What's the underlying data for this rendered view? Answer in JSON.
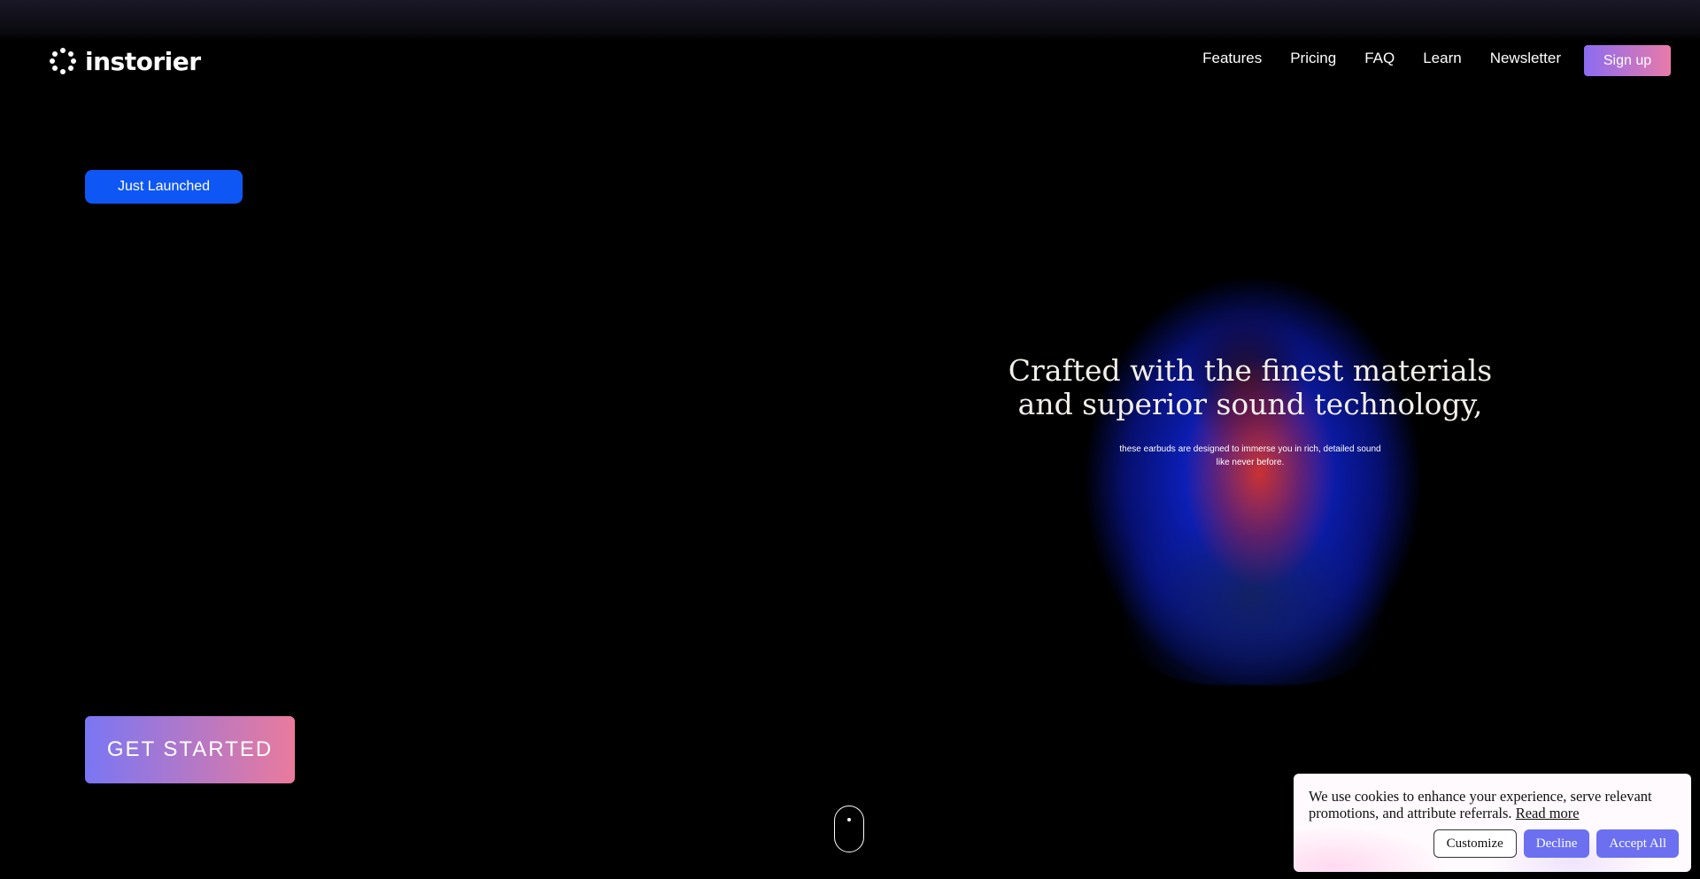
{
  "header": {
    "logo_text": "instorier",
    "logo_icon": "sparkle-dots-icon",
    "nav": [
      "Features",
      "Pricing",
      "FAQ",
      "Learn",
      "Newsletter"
    ],
    "signup_label": "Sign up"
  },
  "hero": {
    "badge": "Just Launched",
    "title": "Crafted with the finest materials and superior sound technology,",
    "subtitle": "these earbuds are designed to immerse you in rich, detailed sound like never before.",
    "cta_label": "GET STARTED"
  },
  "cookie": {
    "text": "We use cookies to enhance your experience, serve relevant promotions, and attribute referrals.",
    "read_more": "Read more",
    "customize": "Customize",
    "decline": "Decline",
    "accept": "Accept All"
  },
  "colors": {
    "badge": "#0f57f5",
    "signup_gradient": [
      "#8c6cf2",
      "#e87aa8"
    ],
    "cta_gradient": [
      "#7a76f4",
      "#ea7a9c"
    ],
    "cookie_button": "#6b6ff0"
  }
}
